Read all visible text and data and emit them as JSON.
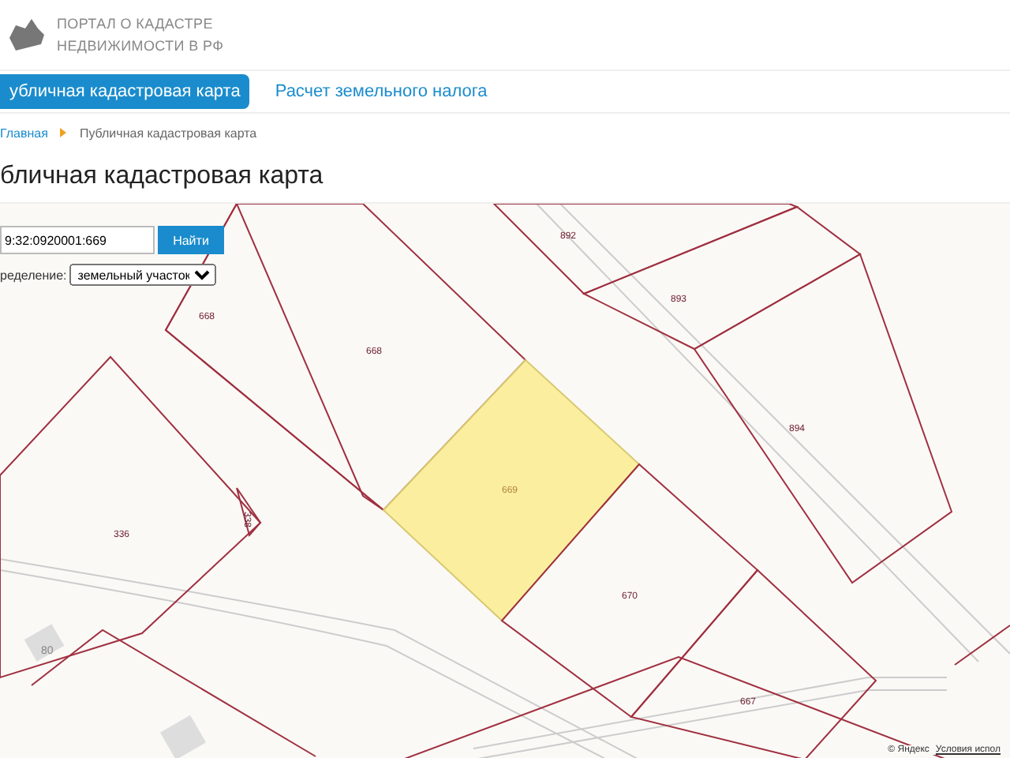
{
  "header": {
    "logo_lines": [
      "ПОРТАЛ О КАДАСТРЕ",
      "НЕДВИЖИМОСТИ В РФ"
    ]
  },
  "nav_tabs": [
    {
      "label": "убличная кадастровая карта",
      "selected": true
    },
    {
      "label": "Расчет земельного налога",
      "selected": false
    }
  ],
  "breadcrumbs": [
    "Главная",
    "Публичная кадастровая карта"
  ],
  "page_title": "бличная кадастровая карта",
  "search": {
    "value": "9:32:0920001:669",
    "button": "Найти"
  },
  "definition": {
    "label": "ределение:",
    "value": "земельный участок"
  },
  "parcels": [
    {
      "label": "892",
      "selected": false
    },
    {
      "label": "893",
      "selected": false
    },
    {
      "label": "894",
      "selected": false
    },
    {
      "label": "668",
      "selected": false
    },
    {
      "label": "668",
      "selected": false
    },
    {
      "label": "669",
      "selected": true
    },
    {
      "label": "670",
      "selected": false
    },
    {
      "label": "667",
      "selected": false
    },
    {
      "label": "336",
      "selected": false
    },
    {
      "label": "338",
      "selected": false
    }
  ],
  "house_label": "80",
  "attribution": {
    "copyright": "© Яндекс",
    "terms": "Условия испол"
  }
}
